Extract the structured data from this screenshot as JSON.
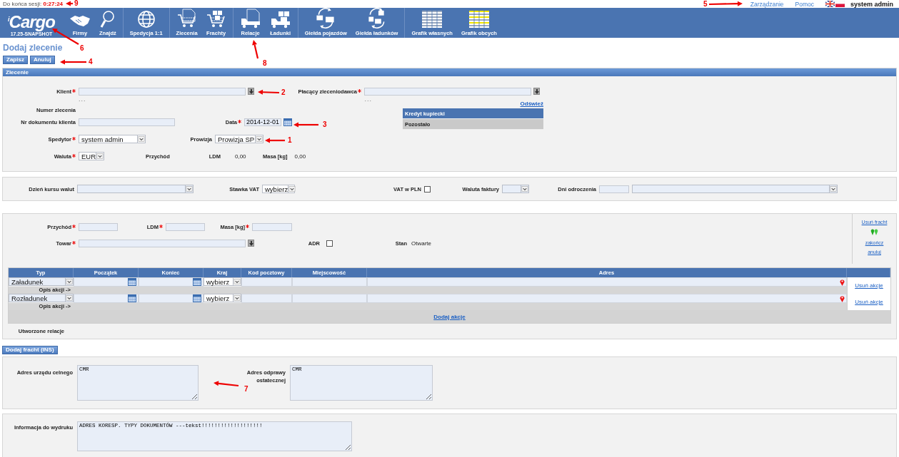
{
  "session": {
    "label": "Do końca sesji:",
    "time": "0:27:24"
  },
  "top_links": [
    {
      "label": "Zarządzanie"
    },
    {
      "label": "Pomoc"
    }
  ],
  "flags": [
    {
      "kind": "uk"
    },
    {
      "kind": "pl"
    }
  ],
  "user": "system admin",
  "nav": {
    "logo_prefix": "i",
    "logo": "Cargo",
    "version": "17.25-SNAPSHOT",
    "groups": [
      {
        "items": [
          {
            "label": "Firmy",
            "kind": "handshake"
          },
          {
            "label": "Znajdź",
            "kind": "search"
          }
        ]
      },
      {
        "items": [
          {
            "label": "Spedycja 1:1",
            "kind": "globe"
          }
        ]
      },
      {
        "items": [
          {
            "label": "Zlecenia",
            "kind": "cart-doc"
          },
          {
            "label": "Frachty",
            "kind": "cart-boxes"
          }
        ]
      },
      {
        "items": [
          {
            "label": "Relacje",
            "kind": "truck-doc"
          },
          {
            "label": "Ładunki",
            "kind": "truck-boxes"
          }
        ]
      },
      {
        "items": [
          {
            "label": "Giełda pojazdów",
            "kind": "exchange-truck"
          },
          {
            "label": "Giełda ładunków",
            "kind": "exchange-boxes"
          }
        ]
      },
      {
        "items": [
          {
            "label": "Grafik własnych",
            "kind": "grid-plain"
          },
          {
            "label": "Grafik obcych",
            "kind": "grid-yellow"
          }
        ]
      }
    ]
  },
  "page_title": "Dodaj zlecenie",
  "buttons": [
    "Zapisz",
    "Anuluj"
  ],
  "order": {
    "title": "Zlecenie",
    "client": {
      "label": "Klient",
      "required": true,
      "hint": "..."
    },
    "payer": {
      "label": "Płacący zleceniodawca",
      "required": true,
      "hint": "..."
    },
    "order_number": {
      "label": "Numer zlecenia"
    },
    "refresh": "Odśwież",
    "credit": [
      {
        "label": "Kredyt kupiecki",
        "kind": "header"
      },
      {
        "label": "Pozostało",
        "kind": "row"
      }
    ],
    "client_doc": {
      "label": "Nr dokumentu klienta"
    },
    "date": {
      "label": "Data",
      "required": true,
      "value": "2014-12-01"
    },
    "forwarder": {
      "label": "Spedytor",
      "required": true,
      "value": "system admin"
    },
    "commission": {
      "label": "Prowizja",
      "value": "Prowizja SP"
    },
    "currency": {
      "label": "Waluta",
      "required": true,
      "value": "EUR"
    },
    "income": {
      "label": "Przychód"
    },
    "ldm": {
      "label": "LDM",
      "value": "0,00"
    },
    "mass": {
      "label": "Masa [kg]",
      "value": "0,00"
    }
  },
  "settings": {
    "rate_day": {
      "label": "Dzień kursu walut"
    },
    "vat_rate": {
      "label": "Stawka VAT",
      "value": "wybierz"
    },
    "vat_pln": {
      "label": "VAT w PLN",
      "checked": false
    },
    "invoice_currency": {
      "label": "Waluta faktury"
    },
    "deferral": {
      "label": "Dni odroczenia"
    }
  },
  "freight": {
    "income": {
      "label": "Przychód",
      "required": true
    },
    "ldm": {
      "label": "LDM",
      "required": true
    },
    "mass": {
      "label": "Masa [kg]",
      "required": true
    },
    "goods": {
      "label": "Towar",
      "required": true
    },
    "adr": {
      "label": "ADR",
      "checked": false
    },
    "status": {
      "label": "Stan",
      "value": "Otwarte"
    },
    "links": [
      "Usuń fracht",
      "zakończ",
      "anuluj"
    ],
    "columns": [
      "Typ",
      "Początek",
      "Koniec",
      "Kraj",
      "Kod pocztowy",
      "Miejscowość",
      "Adres"
    ],
    "rows": [
      {
        "type": "Załadunek",
        "country": "wybierz",
        "note_label": "Opis akcji ->",
        "remove": "Usuń akcje"
      },
      {
        "type": "Rozładunek",
        "country": "wybierz",
        "note_label": "Opis akcji ->",
        "remove": "Usuń akcje"
      }
    ],
    "add_action": "Dodaj akcje",
    "relations_label": "Utworzone relacje"
  },
  "add_freight": "Dodaj fracht (INS)",
  "customs": {
    "office": {
      "label": "Adres urzędu celnego",
      "value": "CMR"
    },
    "final": {
      "label": "Adres odprawy ostatecznej",
      "value": "CMR"
    }
  },
  "print_info": {
    "label": "Informacja do wydruku",
    "value": "ADRES KORESP. TYPY DOKUMENTÓW ---tekst!!!!!!!!!!!!!!!!!!!"
  },
  "annotations": [
    {
      "number": "9"
    },
    {
      "number": "6"
    },
    {
      "number": "4"
    },
    {
      "number": "8"
    },
    {
      "number": "5"
    },
    {
      "number": "2"
    },
    {
      "number": "3"
    },
    {
      "number": "1"
    },
    {
      "number": "7"
    }
  ]
}
